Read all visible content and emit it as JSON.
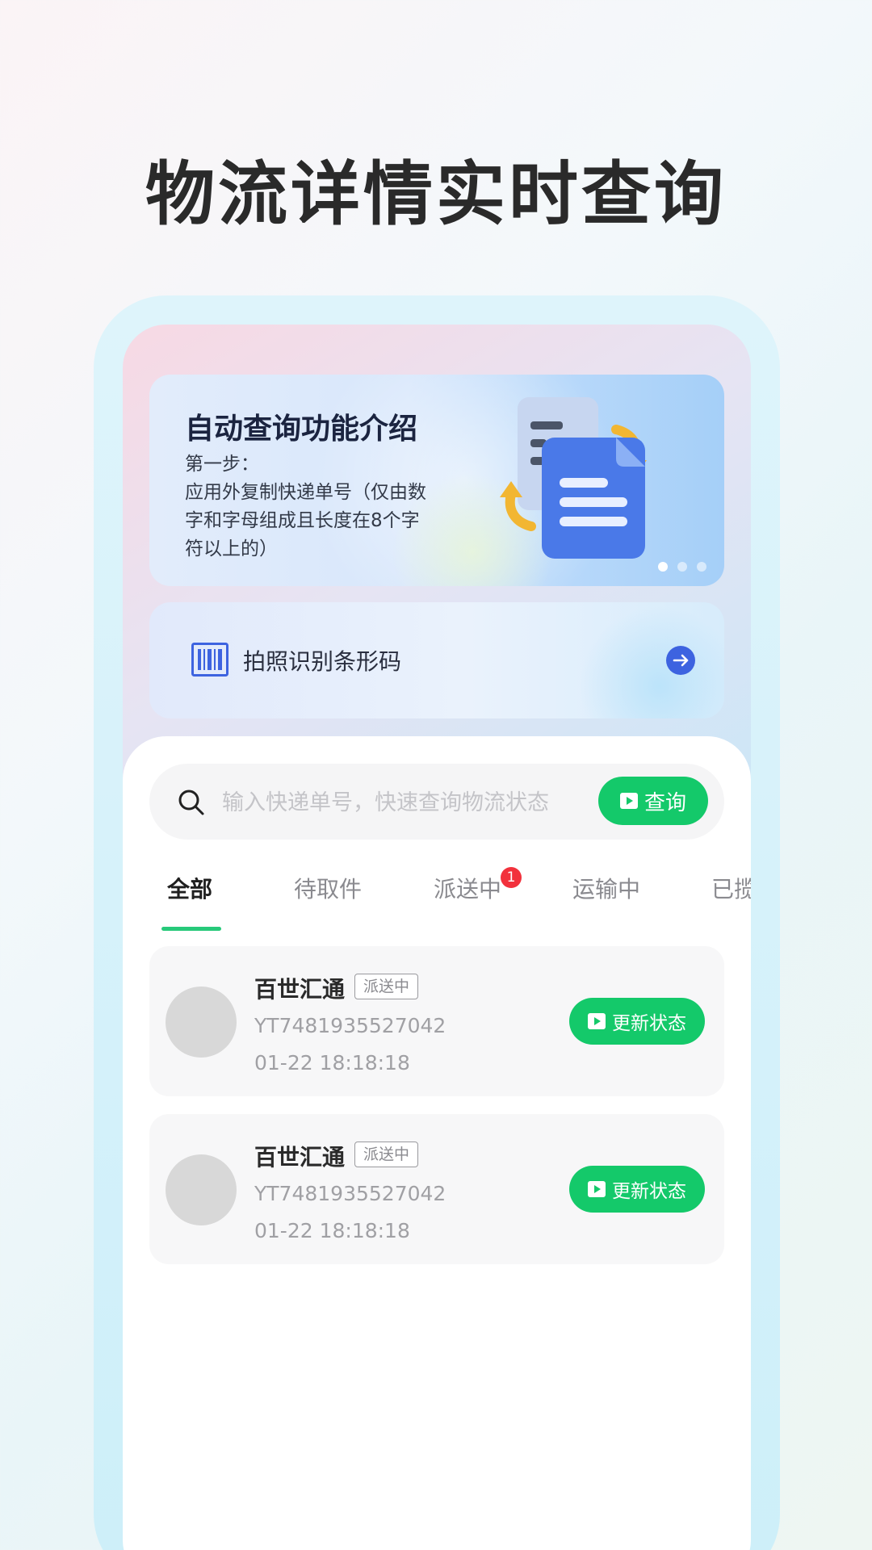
{
  "headline": "物流详情实时查询",
  "banner": {
    "title": "自动查询功能介绍",
    "step": "第一步：",
    "description": "应用外复制快递单号（仅由数字和字母组成且长度在8个字符以上的）",
    "pagination": {
      "total": 3,
      "active": 1
    }
  },
  "scan": {
    "label": "拍照识别条形码",
    "icon": "barcode-icon",
    "action_icon": "arrow-right-icon"
  },
  "search": {
    "placeholder": "输入快递单号，快速查询物流状态",
    "value": "",
    "button_label": "查询"
  },
  "tabs": [
    {
      "label": "全部",
      "active": true
    },
    {
      "label": "待取件",
      "active": false
    },
    {
      "label": "派送中",
      "active": false,
      "badge": "1"
    },
    {
      "label": "运输中",
      "active": false
    },
    {
      "label": "已揽",
      "active": false
    }
  ],
  "shipments": [
    {
      "carrier": "百世汇通",
      "status": "派送中",
      "tracking_number": "YT7481935527042",
      "time": "01-22 18:18:18",
      "action_label": "更新状态"
    },
    {
      "carrier": "百世汇通",
      "status": "派送中",
      "tracking_number": "YT7481935527042",
      "time": "01-22 18:18:18",
      "action_label": "更新状态"
    }
  ],
  "colors": {
    "accent_green": "#14c96a",
    "badge_red": "#f2313c",
    "scan_blue": "#3d63e0"
  }
}
